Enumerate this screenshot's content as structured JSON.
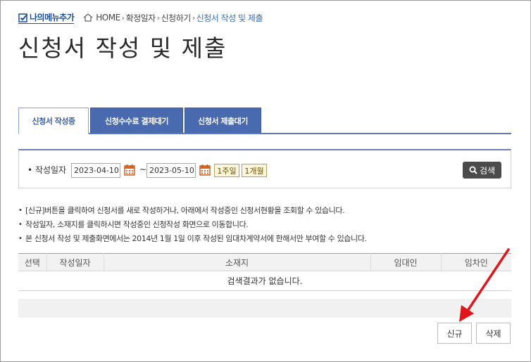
{
  "header": {
    "my_menu_label": "나의메뉴추가",
    "breadcrumb": {
      "home": "HOME",
      "items": [
        "확정일자",
        "신청하기",
        "신청서 작성 및 제출"
      ]
    }
  },
  "page": {
    "title": "신청서 작성 및 제출"
  },
  "tabs": [
    {
      "label": "신청서 작성중",
      "active": true
    },
    {
      "label": "신청수수료 결제대기",
      "active": false
    },
    {
      "label": "신청서 제출대기",
      "active": false
    }
  ],
  "search": {
    "label": "작성일자",
    "from_date": "2023-04-10",
    "tilde": "~",
    "to_date": "2023-05-10",
    "period_1week": "1주일",
    "period_1month": "1개월",
    "search_button": "검색"
  },
  "notes": [
    "[신규]버튼을 클릭하여 신청서를 새로 작성하거나, 아래에서 작성중인 신청서현황을 조회할 수 있습니다.",
    "작성일자, 소재지를 클릭하시면 작성중인 신청작성 화면으로 이동합니다.",
    "본 신청서 작성 및 제출화면에서는 2014년 1월 1일 이후 작성된 임대차계약서에 한해서만 부여할 수 있습니다."
  ],
  "table": {
    "columns": [
      "선택",
      "작성일자",
      "소재지",
      "임대인",
      "임차인"
    ],
    "empty_message": "검색결과가 없습니다."
  },
  "actions": {
    "new_label": "신규",
    "delete_label": "삭제"
  },
  "colors": {
    "tab_inactive": "#4a6ab0",
    "tab_active_text": "#3a5fa8",
    "accent_link": "#2f6fbd",
    "search_button": "#4b4b4b",
    "annotation_arrow": "#e0161c"
  }
}
